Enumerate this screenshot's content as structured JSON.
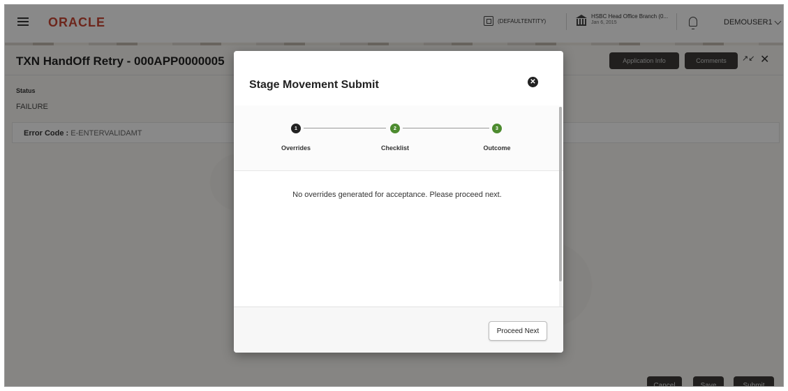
{
  "header": {
    "logo": "ORACLE",
    "entity": "(DEFAULTENTITY)",
    "branch_name": "HSBC Head Office Branch (0...",
    "branch_date": "Jan 6, 2015",
    "user": "DEMOUSER1"
  },
  "page": {
    "title": "TXN HandOff Retry - 000APP0000005",
    "application_info_label": "Application Info",
    "comments_label": "Comments",
    "status_label": "Status",
    "status_value": "FAILURE",
    "error_code_label": "Error Code :",
    "error_code_value": "E-ENTERVALIDAMT",
    "footer": {
      "cancel_label": "Cancel",
      "save_label": "Save",
      "submit_label": "Submit"
    }
  },
  "modal": {
    "title": "Stage Movement Submit",
    "steps": [
      {
        "number": "1",
        "label": "Overrides",
        "color": "#222222"
      },
      {
        "number": "2",
        "label": "Checklist",
        "color": "#4d8b2f"
      },
      {
        "number": "3",
        "label": "Outcome",
        "color": "#4d8b2f"
      }
    ],
    "message": "No overrides generated for acceptance. Please proceed next.",
    "proceed_label": "Proceed Next"
  },
  "colors": {
    "oracle_red": "#c74634",
    "step_active": "#222222",
    "step_pending": "#4d8b2f",
    "dark_button": "#3c3a37"
  },
  "icons": [
    "hamburger-icon",
    "entity-icon",
    "bank-icon",
    "bell-icon",
    "chevron-down-icon",
    "expand-icon",
    "close-icon",
    "modal-close-icon"
  ]
}
